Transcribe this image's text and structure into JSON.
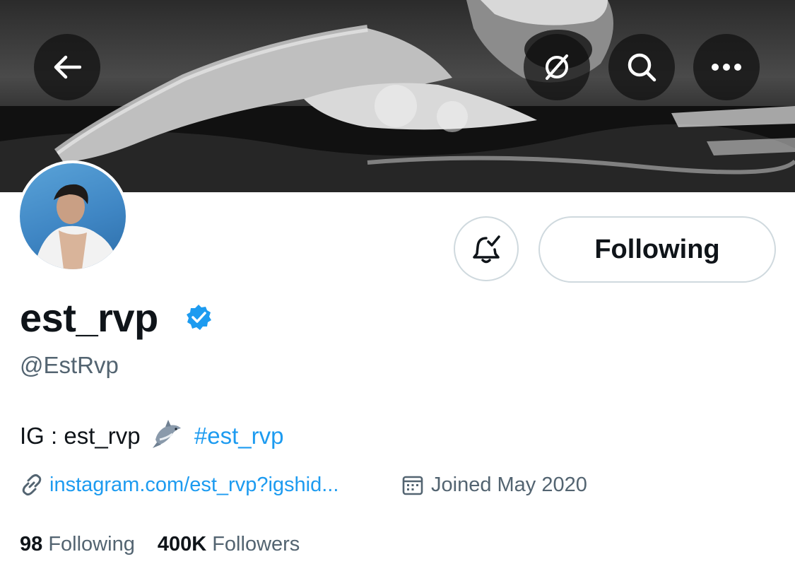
{
  "header": {
    "back_icon": "arrow-left-icon",
    "grok_icon": "slashed-circle-icon",
    "search_icon": "search-icon",
    "more_icon": "more-horizontal-icon"
  },
  "profile": {
    "display_name": "est_rvp",
    "handle": "@EstRvp",
    "verified": true,
    "bio_text": "IG : est_rvp",
    "bio_emoji": "shark",
    "bio_hashtag": "#est_rvp",
    "website": "instagram.com/est_rvp?igshid...",
    "joined": "Joined May 2020"
  },
  "actions": {
    "notifications_icon": "bell-check-icon",
    "follow_label": "Following"
  },
  "stats": {
    "following_count": "98",
    "following_label": "Following",
    "followers_count": "400K",
    "followers_label": "Followers"
  },
  "colors": {
    "link": "#1d9bf0",
    "secondary_text": "#536471",
    "verified": "#1d9bf0",
    "border": "#cfd9de"
  }
}
